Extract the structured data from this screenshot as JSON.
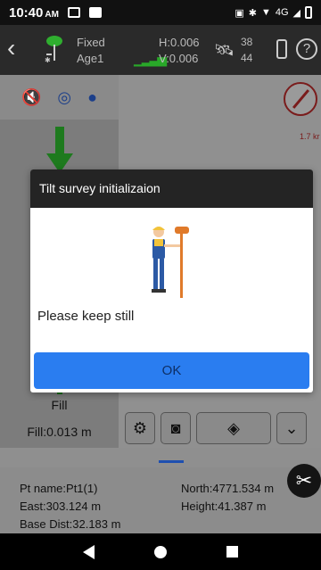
{
  "status_bar": {
    "time": "10:40",
    "ampm": "AM",
    "network": "4G"
  },
  "header": {
    "fix_status": "Fixed",
    "age": "Age1",
    "h_precision": "H:0.006",
    "v_precision": "V:0.006",
    "sat_used": "38",
    "sat_total": "44",
    "help": "?"
  },
  "background": {
    "scale_text": "1.7 kr",
    "fill_label": "Fill",
    "fill_value": "Fill:0.013 m"
  },
  "point_info": {
    "pt_name": "Pt name:Pt1(1)",
    "east": "East:303.124 m",
    "base_dist": "Base Dist:32.183 m",
    "north": "North:4771.534 m",
    "height": "Height:41.387 m"
  },
  "dialog": {
    "title": "Tilt survey initializaion",
    "message": "Please keep still",
    "ok_label": "OK"
  },
  "colors": {
    "accent": "#2a7df0",
    "fix_green": "#29a829"
  }
}
